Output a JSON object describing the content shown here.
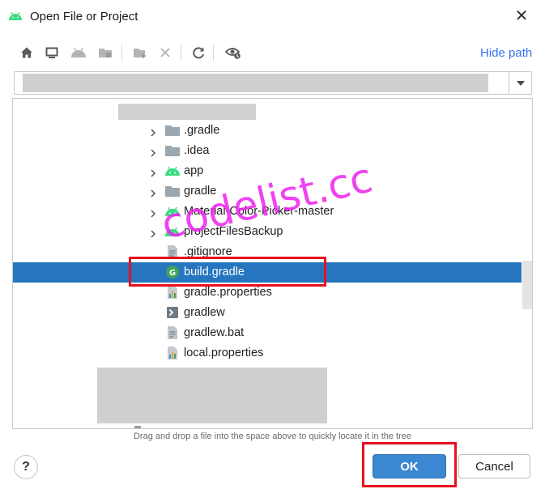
{
  "window": {
    "title": "Open File or Project",
    "app_icon": "android-icon",
    "close_glyph": "✕"
  },
  "toolbar": {
    "buttons": [
      {
        "name": "home-icon"
      },
      {
        "name": "desktop-icon"
      },
      {
        "name": "android-project-icon"
      },
      {
        "name": "module-icon"
      },
      {
        "name": "new-folder-icon"
      },
      {
        "name": "delete-icon"
      },
      {
        "name": "refresh-icon"
      },
      {
        "name": "show-hidden-icon"
      }
    ],
    "hide_path_label": "Hide path"
  },
  "path": {
    "value": ""
  },
  "tree": {
    "items": [
      {
        "label": ".gradle",
        "icon": "folder-icon",
        "expandable": true
      },
      {
        "label": ".idea",
        "icon": "folder-icon",
        "expandable": true
      },
      {
        "label": "app",
        "icon": "android-module-icon",
        "expandable": true
      },
      {
        "label": "gradle",
        "icon": "folder-icon",
        "expandable": true
      },
      {
        "label": "Material-Color-Picker-master",
        "icon": "android-module-icon",
        "expandable": true
      },
      {
        "label": "projectFilesBackup",
        "icon": "android-module-icon",
        "expandable": true
      },
      {
        "label": ".gitignore",
        "icon": "text-file-icon",
        "expandable": false
      },
      {
        "label": "build.gradle",
        "icon": "gradle-file-icon",
        "expandable": false,
        "selected": true
      },
      {
        "label": "gradle.properties",
        "icon": "properties-file-icon",
        "expandable": false
      },
      {
        "label": "gradlew",
        "icon": "script-file-icon",
        "expandable": false
      },
      {
        "label": "gradlew.bat",
        "icon": "text-file-icon",
        "expandable": false
      },
      {
        "label": "local.properties",
        "icon": "properties-file-icon",
        "expandable": false
      }
    ]
  },
  "hint": "Drag and drop a file into the space above to quickly locate it in the tree",
  "footer": {
    "help_label": "?",
    "ok_label": "OK",
    "cancel_label": "Cancel"
  },
  "watermark": "codelist.cc",
  "colors": {
    "selection": "#2675bf",
    "link": "#3574f0",
    "ok_button": "#3b87d1",
    "annotation": "#e8101e",
    "watermark": "#ee22ee"
  }
}
